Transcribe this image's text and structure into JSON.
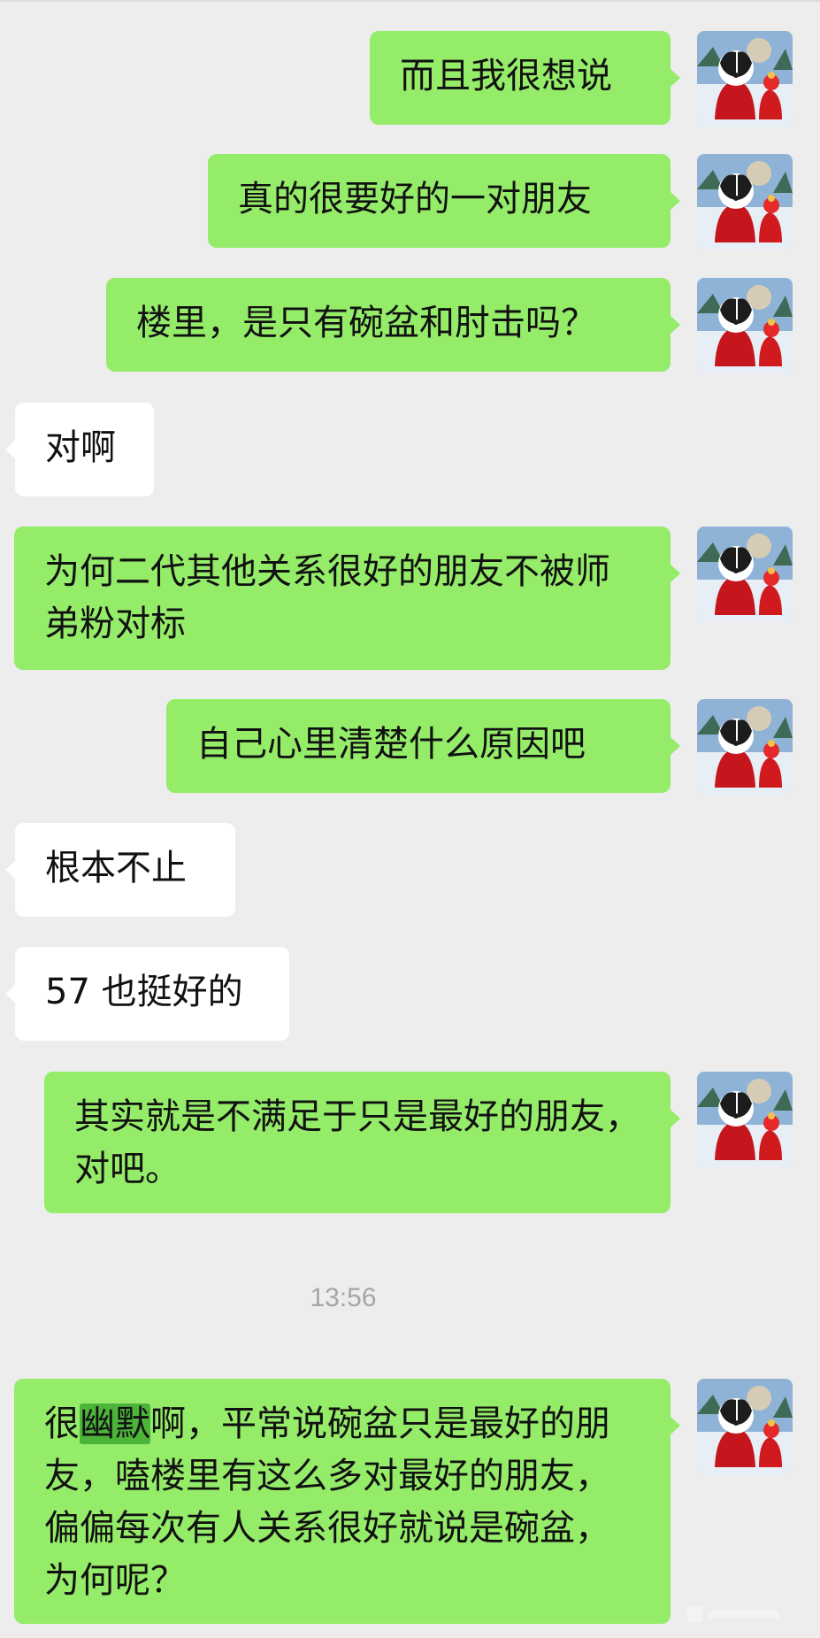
{
  "colors": {
    "background": "#ededed",
    "sent_bubble": "#95ec69",
    "received_bubble": "#ffffff",
    "highlight": "#4db43a",
    "timestamp": "#a6a6a6"
  },
  "icons": {
    "avatar": "avatar-icon",
    "watermark": "watermark-icon"
  },
  "messages": [
    {
      "sender": "me",
      "text": "而且我很想说"
    },
    {
      "sender": "me",
      "text": "真的很要好的一对朋友"
    },
    {
      "sender": "me",
      "text": "楼里，是只有碗盆和肘击吗？"
    },
    {
      "sender": "other",
      "text": "对啊"
    },
    {
      "sender": "me",
      "text": "为何二代其他关系很好的朋友不被师弟粉对标"
    },
    {
      "sender": "me",
      "text": "自己心里清楚什么原因吧"
    },
    {
      "sender": "other",
      "text": "根本不止"
    },
    {
      "sender": "other",
      "text": "57 也挺好的"
    },
    {
      "sender": "me",
      "text": "其实就是不满足于只是最好的朋友，对吧。"
    },
    {
      "sender": "me",
      "text_before": "很",
      "text_highlight": "幽默",
      "text_after": "啊，平常说碗盆只是最好的朋友，嗑楼里有这么多对最好的朋友，偏偏每次有人关系很好就说是碗盆，为何呢？"
    }
  ],
  "timestamp": "13:56"
}
